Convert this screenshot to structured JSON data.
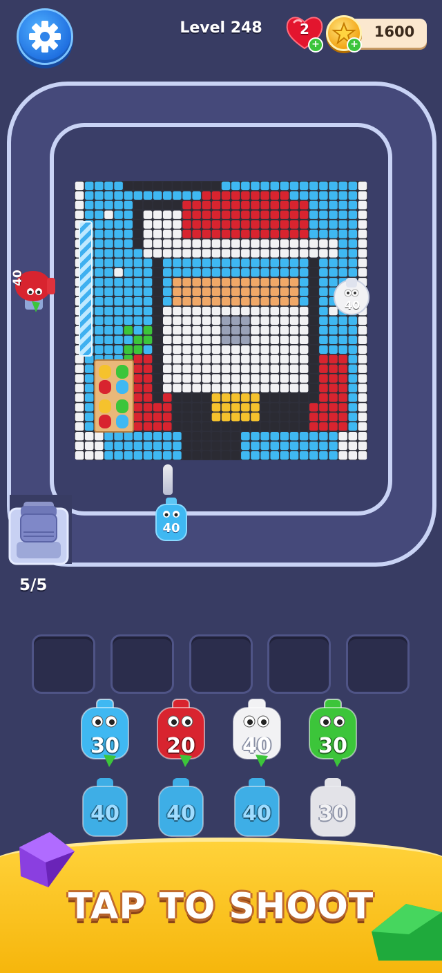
{
  "header": {
    "level_label": "Level 248",
    "lives": "2",
    "coins": "1600"
  },
  "board": {
    "side_shooter_left": "40",
    "side_shooter_right": "40",
    "active_shooter": "40"
  },
  "dispenser": {
    "count": "5/5"
  },
  "shooters": {
    "row1": [
      {
        "value": "30",
        "color": "#3fb8f2"
      },
      {
        "value": "20",
        "color": "#d8242f"
      },
      {
        "value": "40",
        "color": "#f2f2f4"
      },
      {
        "value": "30",
        "color": "#3cc53a"
      }
    ],
    "row2": [
      {
        "value": "40",
        "color": "#3fb8f2"
      },
      {
        "value": "40",
        "color": "#3fb8f2"
      },
      {
        "value": "40",
        "color": "#3fb8f2"
      },
      {
        "value": "30",
        "color": "#f2f2f4"
      }
    ]
  },
  "banner": {
    "cta": "TAP TO SHOOT"
  },
  "colors": {
    "blue": "#3fb8f2",
    "red": "#d8242f",
    "white": "#f2f2f4",
    "green": "#3cc53a",
    "black": "#2b2b33",
    "skin": "#f0a868",
    "gold": "#f5c22d",
    "grey": "#9aa2b8"
  },
  "icons": {
    "settings": "gear-icon",
    "lives": "heart-icon",
    "coins": "coin-star-icon",
    "add": "plus-icon"
  }
}
